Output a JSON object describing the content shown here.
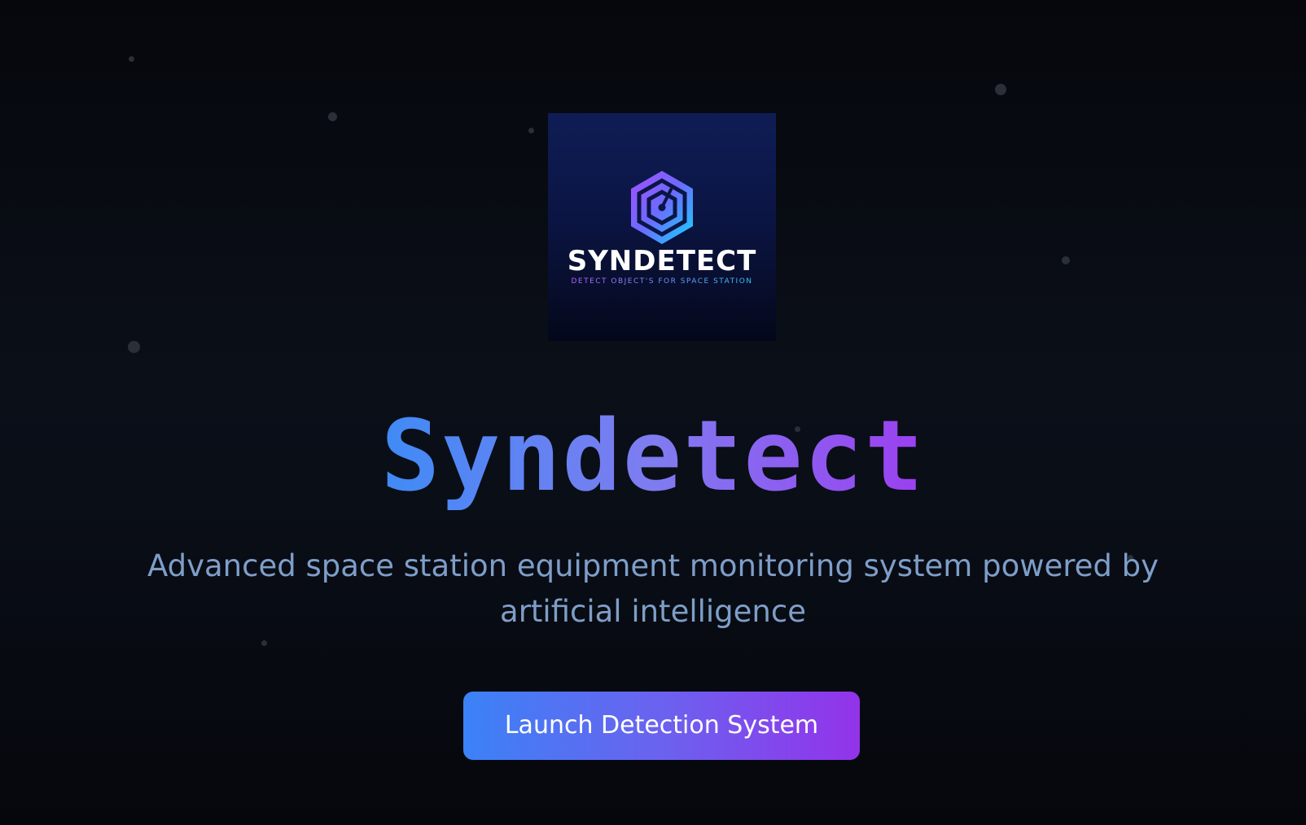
{
  "logo": {
    "wordmark": "SYNDETECT",
    "tagline": "DETECT OBJECT'S FOR SPACE STATION",
    "icon": "hexagon-target-icon"
  },
  "hero": {
    "title": "Syndetect",
    "subtitle": "Advanced space station equipment monitoring system powered by artificial intelligence"
  },
  "cta": {
    "label": "Launch Detection System"
  },
  "colors": {
    "background": "#0a0e17",
    "gradient_start": "#3b82f6",
    "gradient_end": "#9333ea",
    "subtitle": "#7e9ec8",
    "logo_bg": "#0b1544"
  }
}
